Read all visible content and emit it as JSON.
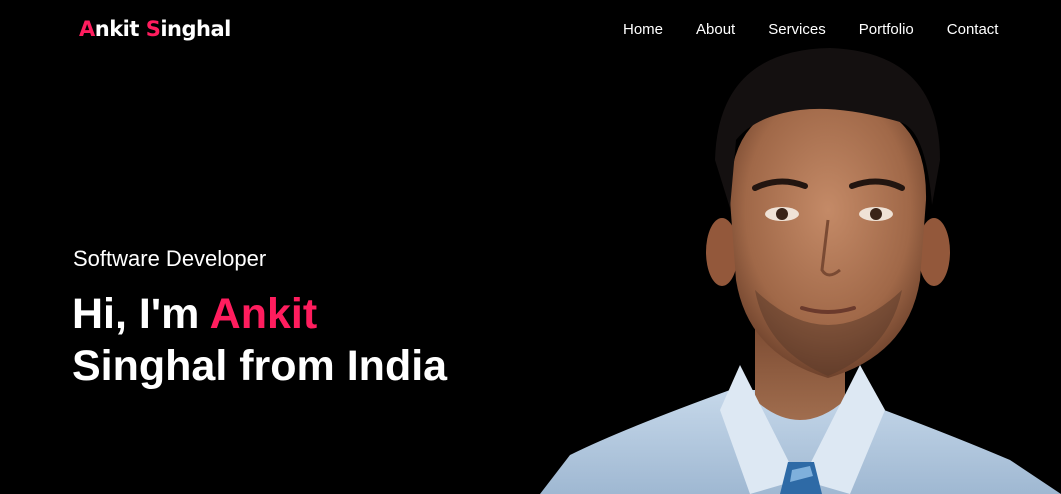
{
  "header": {
    "logo": {
      "first_initial": "A",
      "first_rest": "nkit ",
      "last_initial": "S",
      "last_rest": "inghal"
    },
    "nav": [
      {
        "label": "Home"
      },
      {
        "label": "About"
      },
      {
        "label": "Services"
      },
      {
        "label": "Portfolio"
      },
      {
        "label": "Contact"
      }
    ]
  },
  "hero": {
    "subtitle": "Software Developer",
    "title_prefix": "Hi, I'm ",
    "title_highlight": "Ankit",
    "title_line2": "Singhal from India",
    "image": "portrait-photo"
  },
  "colors": {
    "background": "#000000",
    "text": "#ffffff",
    "accent": "#ff1d5e"
  }
}
